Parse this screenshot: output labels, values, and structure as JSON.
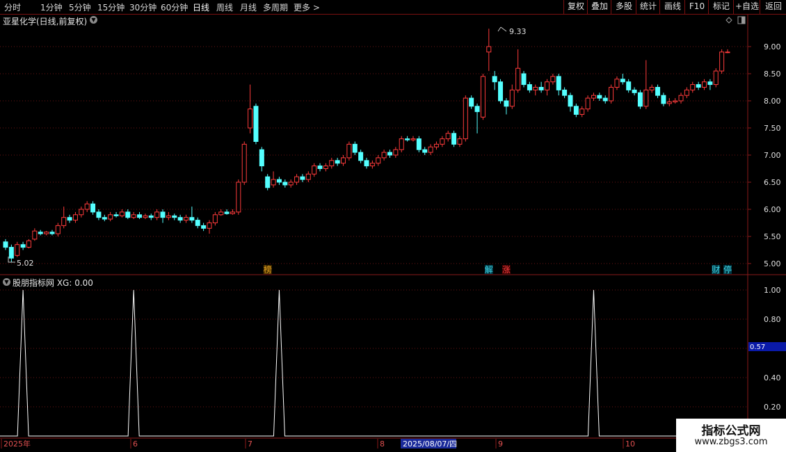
{
  "toolbar": {
    "periods": [
      "分时",
      "1分钟",
      "5分钟",
      "15分钟",
      "30分钟",
      "60分钟",
      "日线",
      "周线",
      "月线",
      "多周期",
      "更多 >"
    ],
    "active_period": "日线",
    "actions": [
      "复权",
      "叠加",
      "多股",
      "统计",
      "画线",
      "F10",
      "标记",
      "+自选",
      "返回"
    ]
  },
  "chart": {
    "title": "亚星化学(日线,前复权)",
    "high_label": "9.33",
    "low_label": "5.02",
    "price_axis": [
      "9.00",
      "8.50",
      "8.00",
      "7.50",
      "7.00",
      "6.50",
      "6.00",
      "5.50",
      "5.00"
    ],
    "event_markers": [
      {
        "text": "榜",
        "color": "#e0a020",
        "bg": "#4a3000"
      },
      {
        "text": "解",
        "color": "#40d8e8",
        "bg": "#003844"
      },
      {
        "text": "涨",
        "color": "#ff4040",
        "bg": "#3a0000"
      },
      {
        "text": "财",
        "color": "#40d8e8",
        "bg": "#003844"
      },
      {
        "text": "停",
        "color": "#40d8e8",
        "bg": "#003844"
      }
    ],
    "up_color": "#ff3b3b",
    "down_color": "#54ffff"
  },
  "indicator": {
    "title": "股朋指标网 XG: 0.00",
    "axis": [
      "1.00",
      "0.80",
      "0.40",
      "0.20"
    ],
    "cursor_value": "0.57",
    "line_color": "#ffffff"
  },
  "date_axis": {
    "labels": [
      "2025年",
      "6",
      "7",
      "8",
      "9",
      "10"
    ],
    "cursor_date": "2025/08/07/四"
  },
  "watermark": {
    "line1": "指标公式网",
    "line2": "www.zbgs3.com"
  },
  "chart_data": {
    "type": "candlestick",
    "title": "亚星化学(日线,前复权)",
    "ylim": [
      4.9,
      9.45
    ],
    "yticks": [
      5.0,
      5.5,
      6.0,
      6.5,
      7.0,
      7.5,
      8.0,
      8.5,
      9.0
    ],
    "candles": [
      [
        5.4,
        5.3,
        5.45,
        5.25
      ],
      [
        5.3,
        5.1,
        5.35,
        5.02
      ],
      [
        5.15,
        5.35,
        5.4,
        5.12
      ],
      [
        5.35,
        5.3,
        5.4,
        5.25
      ],
      [
        5.3,
        5.42,
        5.45,
        5.28
      ],
      [
        5.45,
        5.6,
        5.65,
        5.42
      ],
      [
        5.58,
        5.55,
        5.62,
        5.52
      ],
      [
        5.55,
        5.58,
        5.6,
        5.52
      ],
      [
        5.58,
        5.55,
        5.62,
        5.52
      ],
      [
        5.55,
        5.7,
        5.75,
        5.5
      ],
      [
        5.7,
        5.85,
        6.05,
        5.65
      ],
      [
        5.85,
        5.8,
        5.9,
        5.75
      ],
      [
        5.8,
        5.9,
        5.95,
        5.75
      ],
      [
        5.9,
        6.0,
        6.05,
        5.85
      ],
      [
        6.0,
        6.1,
        6.15,
        5.95
      ],
      [
        6.1,
        5.95,
        6.15,
        5.9
      ],
      [
        5.95,
        5.85,
        6.0,
        5.8
      ],
      [
        5.85,
        5.82,
        5.9,
        5.78
      ],
      [
        5.82,
        5.9,
        5.95,
        5.78
      ],
      [
        5.9,
        5.88,
        5.95,
        5.85
      ],
      [
        5.88,
        5.95,
        6.0,
        5.85
      ],
      [
        5.95,
        5.85,
        6.0,
        5.82
      ],
      [
        5.85,
        5.9,
        5.95,
        5.82
      ],
      [
        5.9,
        5.85,
        5.95,
        5.82
      ],
      [
        5.85,
        5.88,
        5.92,
        5.82
      ],
      [
        5.88,
        5.85,
        5.92,
        5.8
      ],
      [
        5.85,
        5.95,
        6.0,
        5.8
      ],
      [
        5.95,
        5.85,
        6.0,
        5.75
      ],
      [
        5.85,
        5.88,
        5.95,
        5.8
      ],
      [
        5.88,
        5.85,
        5.92,
        5.8
      ],
      [
        5.85,
        5.8,
        5.9,
        5.75
      ],
      [
        5.8,
        5.85,
        5.9,
        5.75
      ],
      [
        5.85,
        5.8,
        6.05,
        5.75
      ],
      [
        5.8,
        5.7,
        5.85,
        5.65
      ],
      [
        5.7,
        5.65,
        5.75,
        5.6
      ],
      [
        5.65,
        5.75,
        5.8,
        5.55
      ],
      [
        5.75,
        5.9,
        5.95,
        5.7
      ],
      [
        5.9,
        5.95,
        6.0,
        5.88
      ],
      [
        5.95,
        5.92,
        6.0,
        5.9
      ],
      [
        5.92,
        5.95,
        6.0,
        5.9
      ],
      [
        5.95,
        6.5,
        6.55,
        5.9
      ],
      [
        6.5,
        7.2,
        7.25,
        6.45
      ],
      [
        7.5,
        7.85,
        8.3,
        7.4
      ],
      [
        7.9,
        7.25,
        7.95,
        7.2
      ],
      [
        7.1,
        6.8,
        7.15,
        6.7
      ],
      [
        6.6,
        6.4,
        6.65,
        6.35
      ],
      [
        6.45,
        6.55,
        6.7,
        6.4
      ],
      [
        6.55,
        6.5,
        6.6,
        6.45
      ],
      [
        6.5,
        6.45,
        6.55,
        6.4
      ],
      [
        6.45,
        6.5,
        6.55,
        6.4
      ],
      [
        6.5,
        6.6,
        6.65,
        6.45
      ],
      [
        6.6,
        6.55,
        6.65,
        6.5
      ],
      [
        6.55,
        6.65,
        6.7,
        6.5
      ],
      [
        6.65,
        6.8,
        6.85,
        6.6
      ],
      [
        6.8,
        6.75,
        6.85,
        6.7
      ],
      [
        6.75,
        6.8,
        6.85,
        6.7
      ],
      [
        6.8,
        6.9,
        6.95,
        6.75
      ],
      [
        6.9,
        6.85,
        6.95,
        6.8
      ],
      [
        6.85,
        6.95,
        7.0,
        6.8
      ],
      [
        6.95,
        7.2,
        7.25,
        6.9
      ],
      [
        7.2,
        7.05,
        7.25,
        7.0
      ],
      [
        7.05,
        6.9,
        7.1,
        6.85
      ],
      [
        6.9,
        6.8,
        6.95,
        6.75
      ],
      [
        6.8,
        6.85,
        6.9,
        6.75
      ],
      [
        6.85,
        6.95,
        7.0,
        6.8
      ],
      [
        6.95,
        7.05,
        7.1,
        6.9
      ],
      [
        7.05,
        7.0,
        7.1,
        6.95
      ],
      [
        7.0,
        7.1,
        7.15,
        6.95
      ],
      [
        7.1,
        7.3,
        7.35,
        7.05
      ],
      [
        7.3,
        7.28,
        7.35,
        7.25
      ],
      [
        7.28,
        7.3,
        7.35,
        7.25
      ],
      [
        7.3,
        7.1,
        7.35,
        7.05
      ],
      [
        7.1,
        7.05,
        7.15,
        7.0
      ],
      [
        7.05,
        7.15,
        7.2,
        7.0
      ],
      [
        7.15,
        7.2,
        7.25,
        7.1
      ],
      [
        7.2,
        7.3,
        7.35,
        7.15
      ],
      [
        7.3,
        7.4,
        7.45,
        7.25
      ],
      [
        7.4,
        7.2,
        7.45,
        7.15
      ],
      [
        7.2,
        7.3,
        7.35,
        7.15
      ],
      [
        7.3,
        8.05,
        8.1,
        7.25
      ],
      [
        8.05,
        7.9,
        8.1,
        7.85
      ],
      [
        7.9,
        7.8,
        7.95,
        7.4
      ],
      [
        7.7,
        8.45,
        8.5,
        7.65
      ],
      [
        8.9,
        9.0,
        9.33,
        8.55
      ],
      [
        8.45,
        8.35,
        8.55,
        8.2
      ],
      [
        8.35,
        8.0,
        8.4,
        7.95
      ],
      [
        8.0,
        7.9,
        8.05,
        7.75
      ],
      [
        7.9,
        8.2,
        8.3,
        7.85
      ],
      [
        8.2,
        8.6,
        8.95,
        8.15
      ],
      [
        8.5,
        8.3,
        8.55,
        8.25
      ],
      [
        8.3,
        8.2,
        8.35,
        8.15
      ],
      [
        8.2,
        8.25,
        8.3,
        8.1
      ],
      [
        8.25,
        8.2,
        8.35,
        8.15
      ],
      [
        8.2,
        8.35,
        8.4,
        8.1
      ],
      [
        8.35,
        8.45,
        8.5,
        8.3
      ],
      [
        8.45,
        8.2,
        8.5,
        8.1
      ],
      [
        8.2,
        8.1,
        8.25,
        8.05
      ],
      [
        8.1,
        7.9,
        8.15,
        7.8
      ],
      [
        7.9,
        7.75,
        7.95,
        7.7
      ],
      [
        7.75,
        7.85,
        7.9,
        7.7
      ],
      [
        7.85,
        8.05,
        8.1,
        7.8
      ],
      [
        8.05,
        8.1,
        8.15,
        8.0
      ],
      [
        8.1,
        8.05,
        8.15,
        8.0
      ],
      [
        8.05,
        8.0,
        8.1,
        7.95
      ],
      [
        8.0,
        8.25,
        8.3,
        7.95
      ],
      [
        8.25,
        8.4,
        8.45,
        8.2
      ],
      [
        8.4,
        8.35,
        8.5,
        8.3
      ],
      [
        8.35,
        8.2,
        8.4,
        8.15
      ],
      [
        8.2,
        8.15,
        8.25,
        8.1
      ],
      [
        8.15,
        7.9,
        8.2,
        7.85
      ],
      [
        7.9,
        8.2,
        8.75,
        7.85
      ],
      [
        8.2,
        8.25,
        8.3,
        8.15
      ],
      [
        8.25,
        8.1,
        8.3,
        8.05
      ],
      [
        8.1,
        7.95,
        8.15,
        7.9
      ],
      [
        7.95,
        7.98,
        8.05,
        7.9
      ],
      [
        7.98,
        8.0,
        8.05,
        7.95
      ],
      [
        8.0,
        8.1,
        8.15,
        7.95
      ],
      [
        8.1,
        8.2,
        8.25,
        8.05
      ],
      [
        8.2,
        8.3,
        8.35,
        8.15
      ],
      [
        8.3,
        8.25,
        8.35,
        8.2
      ],
      [
        8.25,
        8.35,
        8.4,
        8.2
      ],
      [
        8.35,
        8.3,
        8.4,
        8.2
      ],
      [
        8.3,
        8.55,
        8.6,
        8.25
      ],
      [
        8.55,
        8.9,
        8.95,
        8.5
      ],
      [
        8.9,
        8.9,
        8.95,
        8.88
      ]
    ],
    "indicator_peaks": [
      3,
      22,
      47,
      101
    ],
    "indicator_ylim": [
      0,
      1.0
    ]
  }
}
